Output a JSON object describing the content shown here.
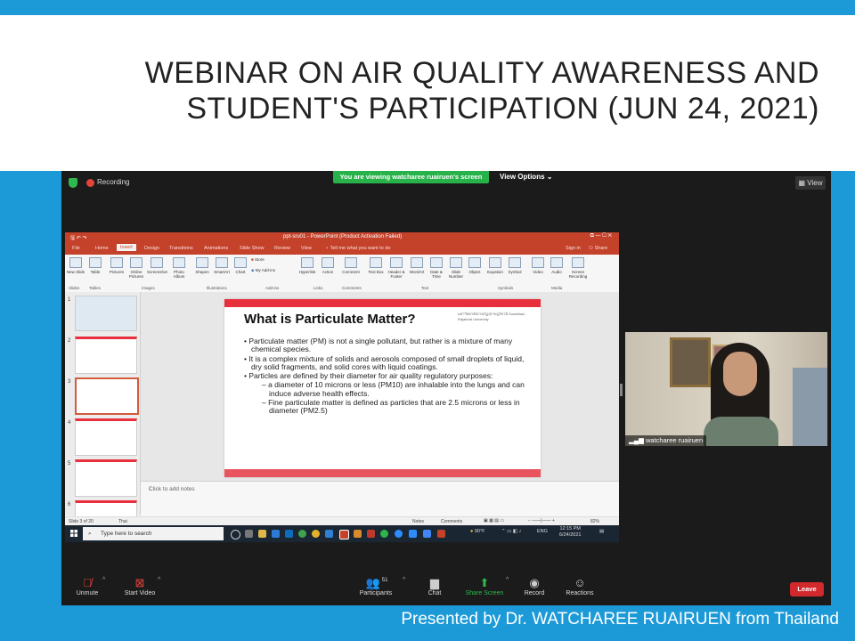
{
  "slide": {
    "title_line1": "WEBINAR ON AIR QUALITY AWARENESS AND",
    "title_line2": "STUDENT'S PARTICIPATION (JUN 24, 2021)",
    "credit": "Presented by Dr. WATCHAREE RUAIRUEN from Thailand",
    "accent_color": "#1c9ad8"
  },
  "zoom": {
    "recording_label": "Recording",
    "viewing_banner": "You are viewing watcharee ruairuen's screen",
    "view_options": "View Options ⌄",
    "view_button": "View",
    "participant_name": "watcharee ruairuen",
    "participants_count": "51",
    "controls": {
      "unmute": "Unmute",
      "start_video": "Start Video",
      "participants": "Participants",
      "chat": "Chat",
      "share_screen": "Share Screen",
      "record": "Record",
      "reactions": "Reactions",
      "leave": "Leave"
    }
  },
  "ppt": {
    "window_title": "ppt-sru01 - PowerPoint (Product Activation Failed)",
    "sign_in": "Sign in",
    "share": "Share",
    "tabs": [
      "File",
      "Home",
      "Insert",
      "Design",
      "Transitions",
      "Animations",
      "Slide Show",
      "Review",
      "View"
    ],
    "tell_me": "Tell me what you want to do",
    "ribbon": {
      "new_slide": "New Slide",
      "table": "Table",
      "pictures": "Pictures",
      "online_pictures": "Online Pictures",
      "screenshot": "Screenshot",
      "photo_album": "Photo Album",
      "shapes": "Shapes",
      "smartart": "SmartArt",
      "chart": "Chart",
      "store": "Store",
      "my_addins": "My Add-ins",
      "hyperlink": "Hyperlink",
      "action": "Action",
      "comment": "Comment",
      "text_box": "Text Box",
      "header_footer": "Header & Footer",
      "wordart": "WordArt",
      "date_time": "Date & Time",
      "slide_number": "Slide Number",
      "object": "Object",
      "equation": "Equation",
      "symbol": "Symbol",
      "video": "Video",
      "audio": "Audio",
      "screen_recording": "Screen Recording"
    },
    "groups": [
      "Slides",
      "Tables",
      "Images",
      "Illustrations",
      "Add-ins",
      "Links",
      "Comments",
      "Text",
      "Symbols",
      "Media"
    ],
    "thumb_numbers": [
      "1",
      "2",
      "3",
      "4",
      "5",
      "6"
    ],
    "notes_placeholder": "Click to add notes",
    "status_left": "Slide 3 of 20",
    "status_lang": "Thai",
    "status_notes": "Notes",
    "status_comments": "Comments",
    "zoom_level": "82%",
    "taskbar_search": "Type here to search",
    "weather": "90°F",
    "keyboard": "ENG",
    "clock_time": "12:15 PM",
    "clock_date": "6/24/2021"
  },
  "content_slide": {
    "title": "What is Particulate Matter?",
    "university": "มหาวิทยาลัยราชภัฏสุราษฎร์ธานี Suratthani Rajabhat University",
    "bullets": [
      "Particulate matter (PM) is not a single pollutant, but rather is a mixture of many chemical species.",
      "It is a complex mixture of solids and aerosols composed of small droplets of liquid, dry solid fragments, and solid cores with liquid coatings.",
      "Particles are defined by their diameter for air quality regulatory purposes:"
    ],
    "sub_bullets": [
      "a diameter of 10 microns or less (PM10) are inhalable into the lungs and can induce adverse health effects.",
      "Fine particulate matter is defined as particles that are 2.5 microns or less in diameter (PM2.5)"
    ]
  }
}
